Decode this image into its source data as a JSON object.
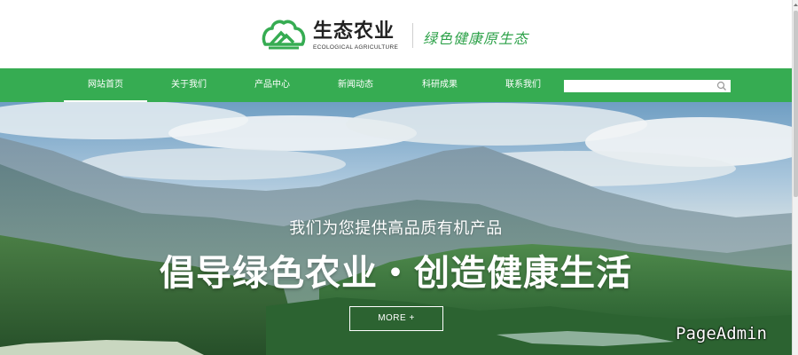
{
  "header": {
    "logo_cn": "生态农业",
    "logo_en": "ECOLOGICAL AGRICULTURE",
    "slogan": "绿色健康原生态",
    "brand_color": "#36ac52"
  },
  "nav": {
    "items": [
      {
        "label": "网站首页",
        "active": true
      },
      {
        "label": "关于我们",
        "active": false
      },
      {
        "label": "产品中心",
        "active": false
      },
      {
        "label": "新闻动态",
        "active": false
      },
      {
        "label": "科研成果",
        "active": false
      },
      {
        "label": "联系我们",
        "active": false
      }
    ],
    "search": {
      "value": "",
      "placeholder": "",
      "icon": "search-icon"
    }
  },
  "hero": {
    "subtitle": "我们为您提供高品质有机产品",
    "title": "倡导绿色农业・创造健康生活",
    "more_label": "MORE +",
    "watermark": "PageAdmin"
  }
}
